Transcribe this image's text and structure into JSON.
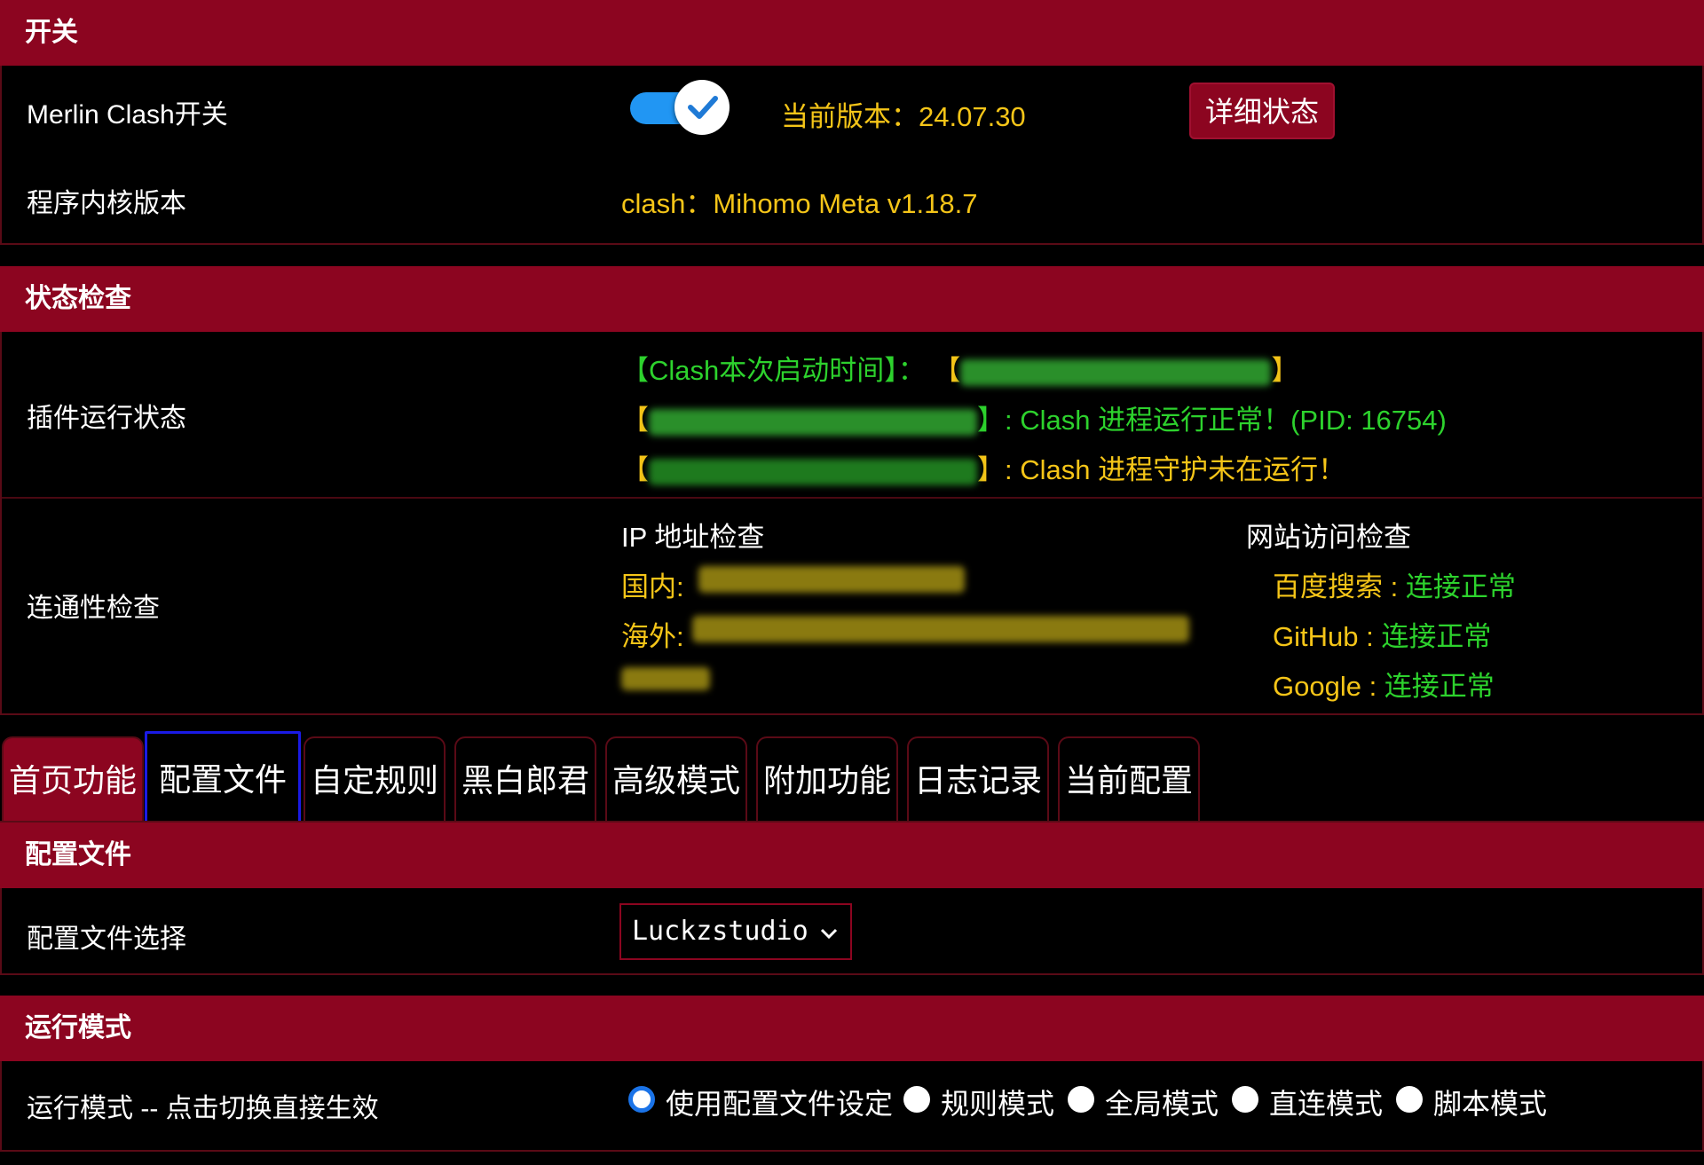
{
  "section_switch": {
    "title": "开关",
    "switch_label": "Merlin Clash开关",
    "switch_on": true,
    "version_text": "当前版本：24.07.30",
    "detail_button": "详细状态",
    "core_label": "程序内核版本",
    "core_value": "clash：Mihomo Meta v1.18.7"
  },
  "section_status": {
    "title": "状态检查",
    "plugin_label": "插件运行状态",
    "start_time_label": "【Clash本次启动时间】：",
    "bracket_open": "【",
    "bracket_close": "】",
    "process_msg": "】: Clash 进程运行正常！(PID: 16754)",
    "guard_msg": "】: Clash 进程守护未在运行！",
    "conn_label": "连通性检查",
    "ip_title": "IP 地址检查",
    "domestic_label": "国内:",
    "overseas_label": "海外:",
    "site_title": "网站访问检查",
    "sites": [
      {
        "name": "百度搜索",
        "sep": " : ",
        "status": "连接正常"
      },
      {
        "name": "GitHub",
        "sep": " : ",
        "status": "连接正常"
      },
      {
        "name": "Google",
        "sep": " : ",
        "status": "连接正常"
      }
    ]
  },
  "tabs": [
    {
      "label": "首页功能",
      "active": true
    },
    {
      "label": "配置文件",
      "focused": true
    },
    {
      "label": "自定规则"
    },
    {
      "label": "黑白郎君"
    },
    {
      "label": "高级模式"
    },
    {
      "label": "附加功能"
    },
    {
      "label": "日志记录"
    },
    {
      "label": "当前配置"
    }
  ],
  "section_config": {
    "title": "配置文件",
    "select_label": "配置文件选择",
    "select_value": "Luckzstudio"
  },
  "section_mode": {
    "title": "运行模式",
    "mode_label": "运行模式 -- 点击切换直接生效",
    "options": [
      {
        "label": "使用配置文件设定",
        "checked": true
      },
      {
        "label": "规则模式"
      },
      {
        "label": "全局模式"
      },
      {
        "label": "直连模式"
      },
      {
        "label": "脚本模式"
      }
    ]
  },
  "colors": {
    "header_bg": "#8c0520",
    "accent_yellow": "#f5c518",
    "accent_green": "#2dd22d",
    "toggle_blue": "#2196f3",
    "focus_blue": "#1a1ae6"
  }
}
